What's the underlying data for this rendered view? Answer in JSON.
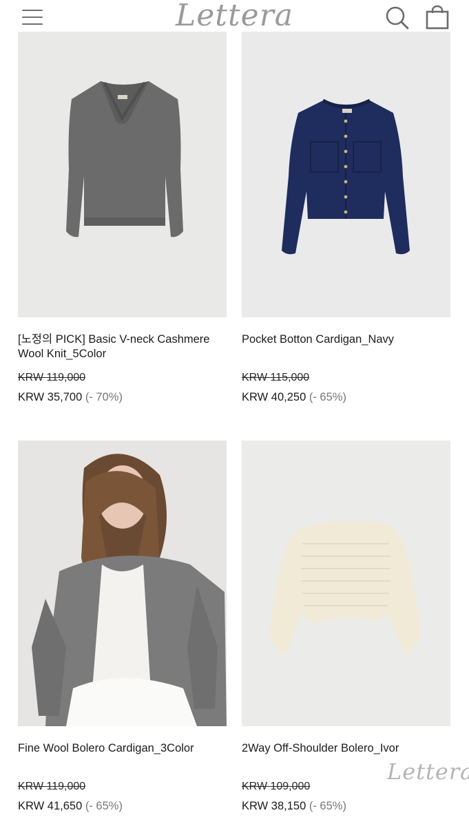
{
  "header": {
    "logo": "Lettera",
    "menu_icon": "hamburger-menu-icon",
    "search_icon": "search-icon",
    "cart_icon": "shopping-bag-icon"
  },
  "products": [
    {
      "title": "[노정의 PICK] Basic V-neck Cashmere Wool Knit_5Color",
      "original_price": "KRW 119,000",
      "sale_price": "KRW 35,700",
      "discount": "(- 70%)",
      "image": "gray-vneck-sweater",
      "bg_color": "#e9e9e8",
      "item_color": "#6b6b6b"
    },
    {
      "title": "Pocket Botton Cardigan_Navy",
      "original_price": "KRW 115,000",
      "sale_price": "KRW 40,250",
      "discount": "(- 65%)",
      "image": "navy-pocket-cardigan",
      "bg_color": "#eaeaea",
      "item_color": "#1f2c5e"
    },
    {
      "title": "Fine Wool Bolero Cardigan_3Color",
      "original_price": "KRW 119,000",
      "sale_price": "KRW 41,650",
      "discount": "(- 65%)",
      "image": "model-gray-bolero",
      "bg_color": "#e6e5e3",
      "item_color": "#7b7b7b"
    },
    {
      "title": "2Way Off-Shoulder Bolero_Ivor",
      "original_price": "KRW 109,000",
      "sale_price": "KRW 38,150",
      "discount": "(- 65%)",
      "image": "ivory-offshoulder-bolero",
      "bg_color": "#ebebea",
      "item_color": "#f1ead7"
    }
  ],
  "watermark": "Lettera"
}
